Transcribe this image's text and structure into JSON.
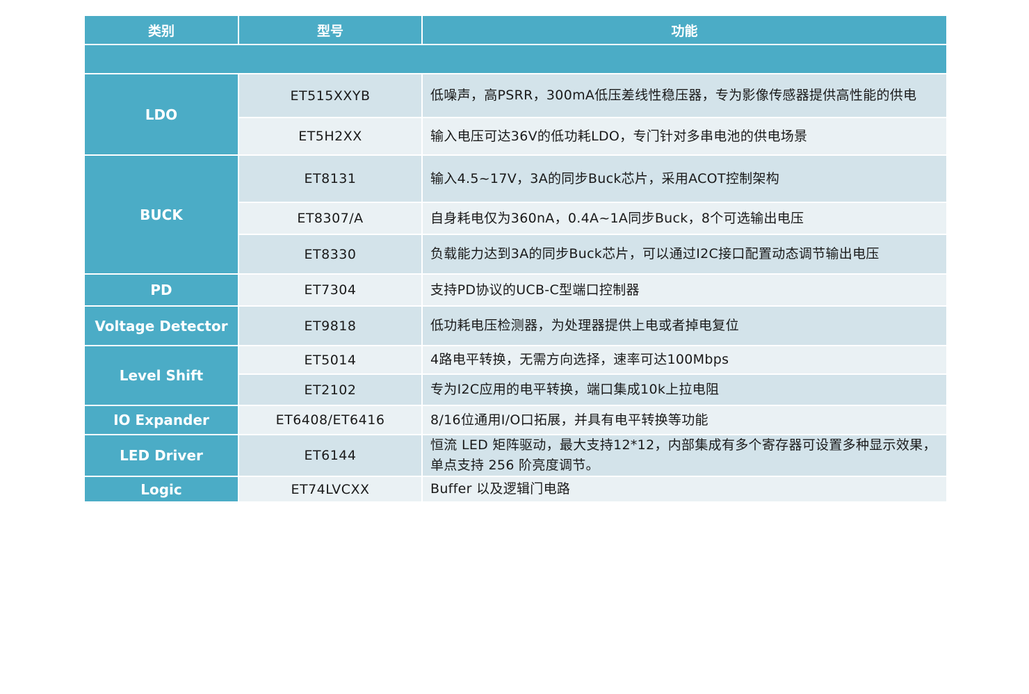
{
  "table": {
    "headers": {
      "category": "类别",
      "model": "型号",
      "function": "功能"
    },
    "rows": [
      {
        "category": "LDO",
        "model": "ET515XXYB",
        "function": "低噪声，高PSRR，300mA低压差线性稳压器，专为影像传感器提供高性能的供电"
      },
      {
        "category": "",
        "model": "ET5H2XX",
        "function": "输入电压可达36V的低功耗LDO，专门针对多串电池的供电场景"
      },
      {
        "category": "BUCK",
        "model": "ET8131",
        "function": "输入4.5~17V，3A的同步Buck芯片，采用ACOT控制架构"
      },
      {
        "category": "",
        "model": "ET8307/A",
        "function": "自身耗电仅为360nA，0.4A~1A同步Buck，8个可选输出电压"
      },
      {
        "category": "",
        "model": "ET8330",
        "function": "负载能力达到3A的同步Buck芯片，可以通过I2C接口配置动态调节输出电压"
      },
      {
        "category": "PD",
        "model": "ET7304",
        "function": "支持PD协议的UCB-C型端口控制器"
      },
      {
        "category": "Voltage Detector",
        "model": "ET9818",
        "function": "低功耗电压检测器，为处理器提供上电或者掉电复位"
      },
      {
        "category": "Level Shift",
        "model": "ET5014",
        "function": "4路电平转换，无需方向选择，速率可达100Mbps"
      },
      {
        "category": "",
        "model": "ET2102",
        "function": "专为I2C应用的电平转换，端口集成10k上拉电阻"
      },
      {
        "category": "IO Expander",
        "model": "ET6408/ET6416",
        "function": "8/16位通用I/O口拓展，并具有电平转换等功能"
      },
      {
        "category": "LED Driver",
        "model": "ET6144",
        "function": "恒流 LED 矩阵驱动，最大支持12*12，内部集成有多个寄存器可设置多种显示效果，单点支持 256 阶亮度调节。"
      },
      {
        "category": "Logic",
        "model": "ET74LVCXX",
        "function": "Buffer 以及逻辑门电路"
      }
    ]
  },
  "colors": {
    "header_bg": "#4bacc6",
    "row_dark": "#d3e3ea",
    "row_light": "#eaf1f4",
    "text": "#1a1a1a"
  }
}
